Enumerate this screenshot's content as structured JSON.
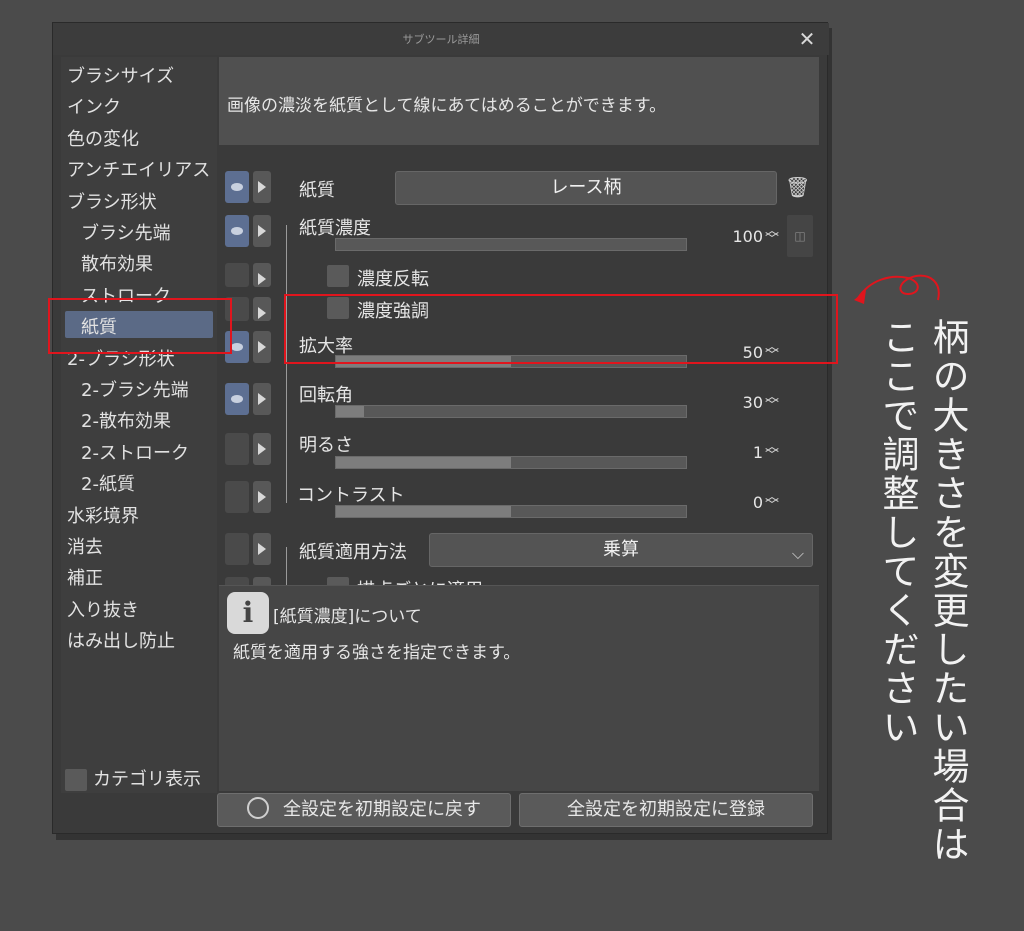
{
  "window": {
    "title": "サブツール詳細",
    "close_icon": "✕"
  },
  "sidebar": {
    "items": [
      {
        "label": "ブラシサイズ",
        "indent": 0
      },
      {
        "label": "インク",
        "indent": 0
      },
      {
        "label": "色の変化",
        "indent": 0
      },
      {
        "label": "アンチエイリアス",
        "indent": 0
      },
      {
        "label": "ブラシ形状",
        "indent": 0
      },
      {
        "label": "ブラシ先端",
        "indent": 1
      },
      {
        "label": "散布効果",
        "indent": 1
      },
      {
        "label": "ストローク",
        "indent": 1
      },
      {
        "label": "紙質",
        "indent": 1,
        "selected": true
      },
      {
        "label": "2-ブラシ形状",
        "indent": 0
      },
      {
        "label": "2-ブラシ先端",
        "indent": 1
      },
      {
        "label": "2-散布効果",
        "indent": 1
      },
      {
        "label": "2-ストローク",
        "indent": 1
      },
      {
        "label": "2-紙質",
        "indent": 1
      },
      {
        "label": "水彩境界",
        "indent": 0
      },
      {
        "label": "消去",
        "indent": 0
      },
      {
        "label": "補正",
        "indent": 0
      },
      {
        "label": "入り抜き",
        "indent": 0
      },
      {
        "label": "はみ出し防止",
        "indent": 0
      }
    ],
    "category_toggle": "カテゴリ表示"
  },
  "description": "画像の濃淡を紙質として線にあてはめることができます。",
  "panel": {
    "texture_label": "紙質",
    "texture_value": "レース柄",
    "density": {
      "label": "紙質濃度",
      "value": "100",
      "fraction": 0.0
    },
    "invert_label": "濃度反転",
    "emphasize_label": "濃度強調",
    "scale": {
      "label": "拡大率",
      "value": "50",
      "fraction": 0.5
    },
    "rotation": {
      "label": "回転角",
      "value": "30",
      "fraction": 0.08
    },
    "brightness": {
      "label": "明るさ",
      "value": "1",
      "fraction": 0.5
    },
    "contrast": {
      "label": "コントラスト",
      "value": "0",
      "fraction": 0.5
    },
    "apply_method": {
      "label": "紙質適用方法",
      "value": "乗算"
    },
    "per_dab_label": "描点ごとに適用"
  },
  "info": {
    "icon": "i",
    "title": "[紙質濃度]について",
    "body": "紙質を適用する強さを指定できます。"
  },
  "buttons": {
    "reset": "全設定を初期設定に戻す",
    "register": "全設定を初期設定に登録"
  },
  "annotation": {
    "line1": "柄の大きさを変更したい場合は",
    "line2": "ここで調整してください",
    "color": "#e0151d"
  }
}
